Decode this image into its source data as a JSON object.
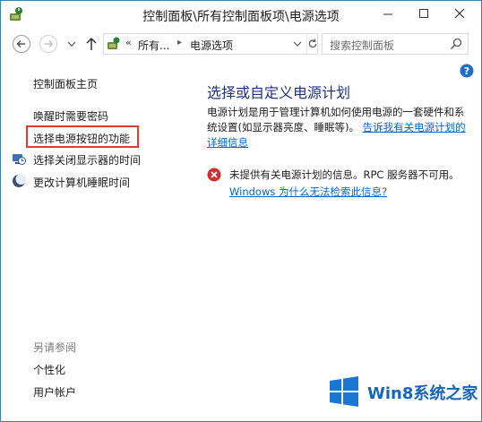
{
  "window": {
    "title": "控制面板\\所有控制面板项\\电源选项"
  },
  "address_bar": {
    "overflow": "«",
    "crumbs": [
      "所有...",
      "电源选项"
    ],
    "separator": "▸"
  },
  "search": {
    "placeholder": "搜索控制面板"
  },
  "sidebar": {
    "home": "控制面板主页",
    "tasks": [
      {
        "label": "唤醒时需要密码",
        "icon": null
      },
      {
        "label": "选择电源按钮的功能",
        "icon": null,
        "highlighted": true
      },
      {
        "label": "选择关闭显示器的时间",
        "icon": "display-clock-icon"
      },
      {
        "label": "更改计算机睡眠时间",
        "icon": "moon-icon"
      }
    ],
    "see_also_heading": "另请参阅",
    "see_also": [
      "个性化",
      "用户帐户"
    ]
  },
  "main": {
    "title": "选择或自定义电源计划",
    "description": "电源计划是用于管理计算机如何使用电源的一套硬件和系统设置(如显示器亮度、睡眠等)。",
    "description_link": "告诉我有关电源计划的详细信息",
    "error_text": "未提供有关电源计划的信息。RPC 服务器不可用。",
    "error_link": "Windows 为什么无法检索此信息?"
  },
  "watermark": {
    "text": "Win8系统之家"
  },
  "colors": {
    "title_blue": "#1e3287",
    "link_blue": "#0066cc",
    "highlight_red": "#e53935",
    "error_red": "#d32f2f",
    "watermark_blue": "#1565c0"
  }
}
